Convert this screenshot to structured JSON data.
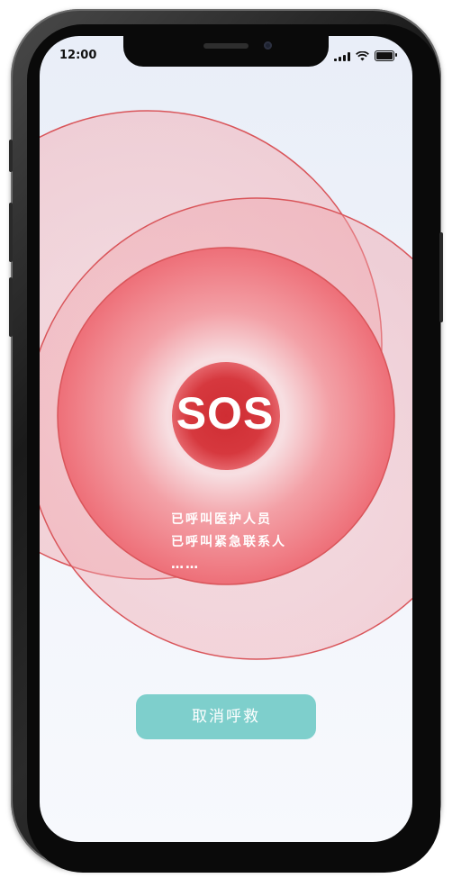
{
  "status_bar": {
    "time": "12:00"
  },
  "sos": {
    "label": "SOS",
    "status_lines": [
      "已呼叫医护人员",
      "已呼叫紧急联系人",
      "……"
    ]
  },
  "actions": {
    "cancel_label": "取消呼救"
  },
  "colors": {
    "accent": "#7ecfcc",
    "sos_red": "#d3383d",
    "ripple_stroke": "#d9555a",
    "screen_bg": "#eef2fa"
  }
}
